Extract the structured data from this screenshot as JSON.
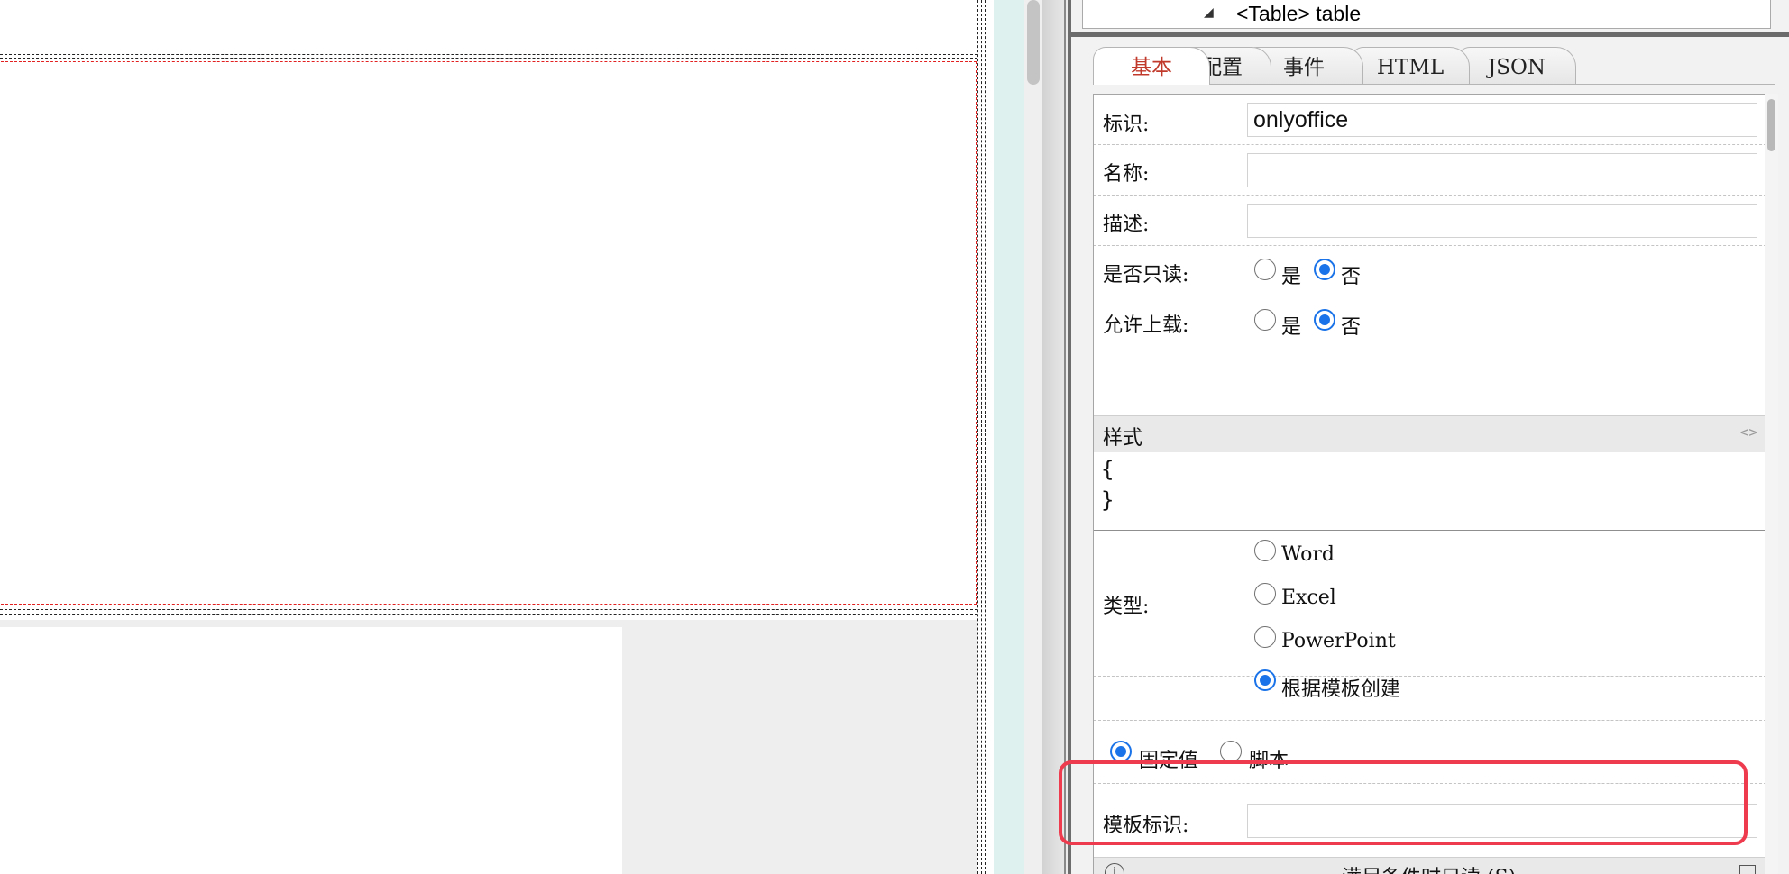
{
  "tree": {
    "node_label": "<Table> table"
  },
  "tabs": [
    {
      "label": "基本",
      "active": true
    },
    {
      "label": "配置",
      "active": false
    },
    {
      "label": "事件",
      "active": false
    },
    {
      "label": "HTML",
      "active": false
    },
    {
      "label": "JSON",
      "active": false
    }
  ],
  "form": {
    "id_label": "标识:",
    "id_value": "onlyoffice",
    "name_label": "名称:",
    "name_value": "",
    "desc_label": "描述:",
    "desc_value": "",
    "readonly": {
      "label": "是否只读:",
      "options": [
        "是",
        "否"
      ],
      "selected": "否"
    },
    "upload": {
      "label": "允许上载:",
      "options": [
        "是",
        "否"
      ],
      "selected": "否"
    },
    "style": {
      "label": "样式",
      "code_icon": "code-icon",
      "open_brace": "{",
      "close_brace": "}"
    },
    "type": {
      "label": "类型:",
      "options": [
        "Word",
        "Excel",
        "PowerPoint",
        "根据模板创建"
      ],
      "selected": "根据模板创建"
    },
    "value_mode": {
      "options": [
        "固定值",
        "脚本"
      ],
      "selected": "固定值"
    },
    "template_id": {
      "label": "模板标识:",
      "value": ""
    },
    "condition_readonly": {
      "label": "满足条件时只读 (S)",
      "icons": [
        "info-icon",
        "window-icon"
      ]
    }
  },
  "colors": {
    "accent_blue": "#1a73e8",
    "active_tab": "#c0392b",
    "highlight": "#ee3b4e",
    "canvas_dash": "#e32020"
  }
}
